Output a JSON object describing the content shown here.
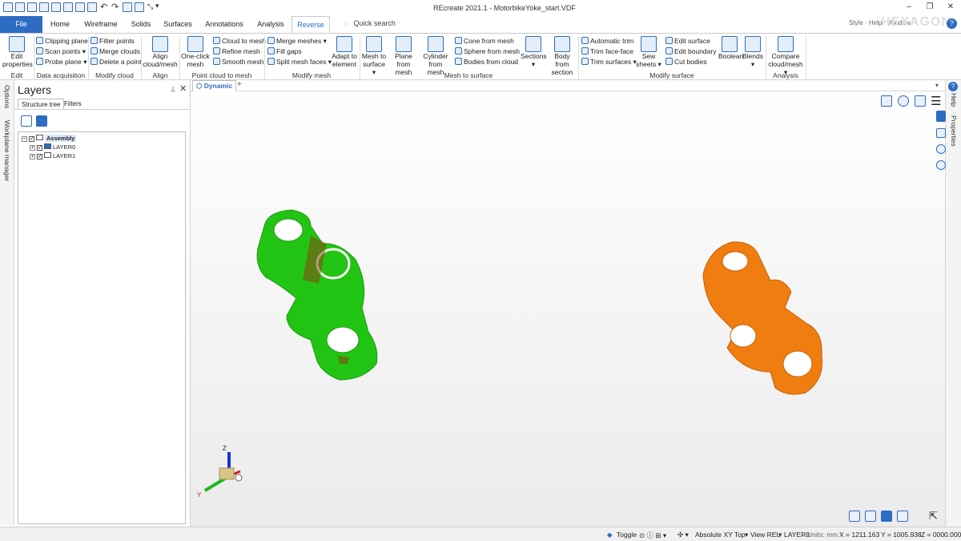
{
  "window": {
    "title": "REcreate 2021.1 - MotorbikeYoke_start.VDF",
    "brand": "HEXAGON",
    "user_label": "Style · Help · Window",
    "controls": [
      "–",
      "❐",
      "✕"
    ]
  },
  "tabs": [
    {
      "label": "File",
      "active": false
    },
    {
      "label": "Home",
      "active": false
    },
    {
      "label": "Wireframe",
      "active": false
    },
    {
      "label": "Solids",
      "active": false
    },
    {
      "label": "Surfaces",
      "active": false
    },
    {
      "label": "Annotations",
      "active": false
    },
    {
      "label": "Analysis",
      "active": false
    },
    {
      "label": "Reverse",
      "active": true
    }
  ],
  "quick_search": {
    "label": "Quick search"
  },
  "ribbon": {
    "edit": {
      "label": "Edit",
      "edit_properties": "Edit properties"
    },
    "data_acquisition": {
      "label": "Data acquisition",
      "items": [
        "Clipping plane",
        "Scan points ▾",
        "Probe plane ▾"
      ]
    },
    "modify_cloud": {
      "label": "Modify cloud",
      "items": [
        "Filter points",
        "Merge clouds",
        "Delete a point"
      ]
    },
    "align": {
      "label": "Align",
      "align_cloud_mesh": "Align cloud/mesh"
    },
    "point_cloud_to_mesh": {
      "label": "Point cloud to mesh",
      "one_click_mesh": "One-click mesh",
      "items": [
        "Cloud to mesh",
        "Refine mesh",
        "Smooth mesh"
      ]
    },
    "modify_mesh": {
      "label": "Modify mesh",
      "items": [
        "Merge meshes ▾",
        "Fill gaps",
        "Split mesh faces ▾"
      ],
      "adapt_to_element": "Adapt to element"
    },
    "mesh_to_surface": {
      "label": "Mesh to surface",
      "mesh_to_surface": "Mesh to surface ▾",
      "plane_from_mesh": "Plane from mesh",
      "cylinder_from_mesh": "Cylinder from mesh",
      "items": [
        "Cone from mesh",
        "Sphere from mesh",
        "Bodies from cloud"
      ],
      "sections": "Sections ▾",
      "body_from_section": "Body from section"
    },
    "modify_surface": {
      "label": "Modify surface",
      "trim_items": [
        "Automatic trim",
        "Trim face-face",
        "Trim surfaces ▾"
      ],
      "sew_sheets": "Sew sheets ▾",
      "edit_items": [
        "Edit surface",
        "Edit boundary",
        "Cut bodies"
      ],
      "boolean": "Boolean",
      "blends": "Blends ▾"
    },
    "analysis": {
      "label": "Analysis",
      "compare": "Compare cloud/mesh ▾"
    }
  },
  "left_strip": {
    "options": "Options",
    "workplane": "Workplane manager"
  },
  "layers_panel": {
    "title": "Layers",
    "tabs": [
      "Structure tree",
      "Filters"
    ],
    "tree": [
      {
        "label": "Assembly",
        "expander": "−",
        "checked": true,
        "indent": 0
      },
      {
        "label": "LAYER0",
        "expander": "+",
        "checked": true,
        "indent": 1
      },
      {
        "label": "LAYER1",
        "expander": "+",
        "checked": true,
        "indent": 1
      }
    ]
  },
  "viewport": {
    "tab": "Dynamic",
    "add_tab": "+",
    "axes": {
      "z": "Z",
      "y": "Y"
    },
    "colors": {
      "green_part": "#22c414",
      "orange_part": "#f07d10",
      "axis_z": "#1c2fd6",
      "axis_y": "#1fb81f",
      "axis_x": "#d81c1c"
    }
  },
  "right_strip": {
    "help": "Help",
    "properties": "Properties"
  },
  "status": {
    "toggle": "Toggle",
    "plane": "Absolute XY Top",
    "view": "View REL",
    "layer": "LAYER0",
    "units": "Units: mm",
    "x": "X = 1211.163",
    "y": "Y = 1005.938",
    "z": "Z = 0000.000"
  }
}
